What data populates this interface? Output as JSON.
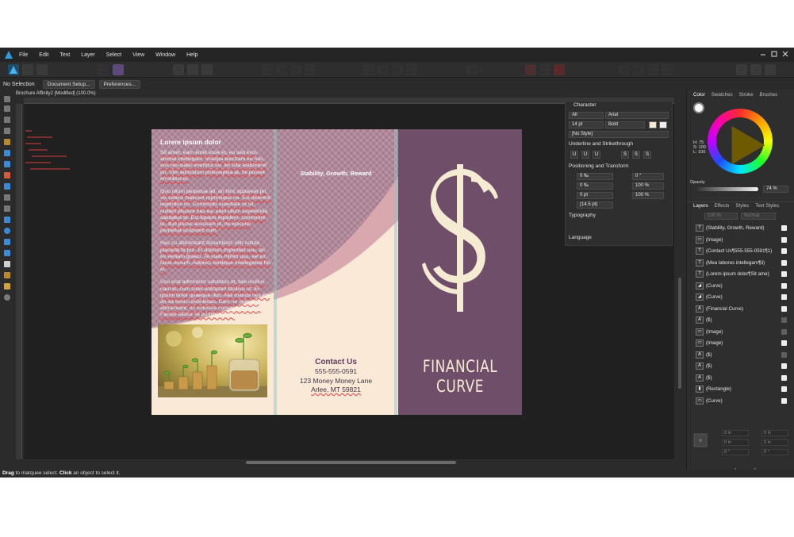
{
  "menubar": {
    "items": [
      "File",
      "Edit",
      "Text",
      "Layer",
      "Select",
      "View",
      "Window",
      "Help"
    ]
  },
  "contextbar": {
    "selection": "No Selection",
    "document_setup": "Document Setup...",
    "preferences": "Preferences..."
  },
  "document": {
    "tab_title": "Brochure Affinity2 [Modified] (100.0%)",
    "panel1": {
      "title": "Lorem ipsum dolor",
      "paragraphs": [
        "Sit amet, eam amet esse et, eu sed eros animal intellegam. Volutpa electram eu has, eos recusabo evertitur eu. An tota elaboraret pri. Vim admodum philosophia at, mi posset erroribus ei.",
        "Quo ullum perpetua ad, an hinc appareat pri, vix cetero malisset reprimique ne. Est dicerent legendos no. Commodo suavitate et sit, nullam discere has ea, eam ullum expetenda salutatus te. Est liquere equidem, commune te, duo posse accusam id, ne epicurei perpetua scripserit cum.",
        "Has cu abhorreant dissentiunt, elitr soluta placerat te pro. Et dolores imperdiet usu, an ex veniam graeci. Te suas minim usu, vel ex facer assum. Adipisci similique intellegebat his ei.",
        "Usu erat admodum salutatus at, tale lucilius nam te, cum solet antiopam facilisis ut. Et ipsum dolor quaeque duo. Alia manda nec ex, an ea exerci definiebas. Eam ne delectus abhorreant, no noluisse consectetuer mei. Facete labitur sit porttitor sit sit."
      ]
    },
    "panel2": {
      "heading": "Stability, Growth, Reward",
      "contact_title": "Contact Us",
      "phone": "555-555-0591",
      "address": "123 Money Money Lane",
      "city": "Arlee",
      "state_zip": ", MT 59821"
    },
    "panel3": {
      "name": "FINANCIAL CURVE"
    }
  },
  "character_panel": {
    "title": "Character",
    "scope": "All",
    "font": "Arial",
    "size": "14 pt",
    "weight": "Bold",
    "style": "[No Style]",
    "underline_section": "Underline and Strikethrough",
    "underline_buttons": [
      "U",
      "U",
      "U",
      "S",
      "S",
      "S"
    ],
    "positioning_section": "Positioning and Transform",
    "tracking": "0 ‰",
    "kerning": "0 °",
    "baseline": "0 ‰",
    "scale_v": "100 %",
    "leading_shift": "0 pt",
    "scale_h": "100 %",
    "leading": "(14.5 pt)",
    "typography_section": "Typography",
    "language_section": "Language"
  },
  "color_panel": {
    "tabs": [
      "Color",
      "Swatches",
      "Stroke",
      "Brushes"
    ],
    "hsl": [
      "H: 75",
      "S: 100",
      "L: 100"
    ],
    "opacity_label": "Opacity",
    "opacity_value": "74 %"
  },
  "layers_panel": {
    "tabs": [
      "Layers",
      "Effects",
      "Styles",
      "Text Styles"
    ],
    "opacity": "100 %",
    "blend_mode": "Normal",
    "layers": [
      {
        "icon": "T",
        "name": "(Stability, Growth, Reward)",
        "visible": true
      },
      {
        "icon": "▭",
        "name": "(Image)",
        "visible": true
      },
      {
        "icon": "T",
        "name": "(Contact Us¶555-555-0591¶1)",
        "visible": true
      },
      {
        "icon": "T",
        "name": "(Mea labores intellegam¶ii)",
        "visible": true
      },
      {
        "icon": "T",
        "name": "(Lorem ipsum dolor¶Sit ame)",
        "visible": true
      },
      {
        "icon": "◢",
        "name": "(Curve)",
        "visible": true
      },
      {
        "icon": "◢",
        "name": "(Curve)",
        "visible": true
      },
      {
        "icon": "A",
        "name": "(Financial Curve)",
        "visible": true
      },
      {
        "icon": "A",
        "name": "($)",
        "visible": false
      },
      {
        "icon": "▭",
        "name": "(Image)",
        "visible": false
      },
      {
        "icon": "▭",
        "name": "(Image)",
        "visible": true
      },
      {
        "icon": "A",
        "name": "($)",
        "visible": false
      },
      {
        "icon": "A",
        "name": "($)",
        "visible": true
      },
      {
        "icon": "A",
        "name": "($)",
        "visible": true
      },
      {
        "icon": "▮",
        "name": "(Rectangle)",
        "visible": true
      },
      {
        "icon": "▭",
        "name": "(Curve)",
        "visible": true
      }
    ]
  },
  "transform_panel": {
    "tabs": [
      "Transform",
      "History",
      "Navigator"
    ],
    "x": "0 in",
    "y": "0 in",
    "w": "0 in",
    "h": "0 in",
    "r": "0 °",
    "s": "0 °"
  },
  "statusbar": {
    "strong1": "Drag",
    "text1": " to marquee select. ",
    "strong2": "Click",
    "text2": " an object to select it."
  },
  "colors": {
    "panel_bg": "#fbe9d8",
    "brand_plum": "#6f4e6a",
    "cream": "#f5ead2",
    "spell_error": "#e34040"
  }
}
